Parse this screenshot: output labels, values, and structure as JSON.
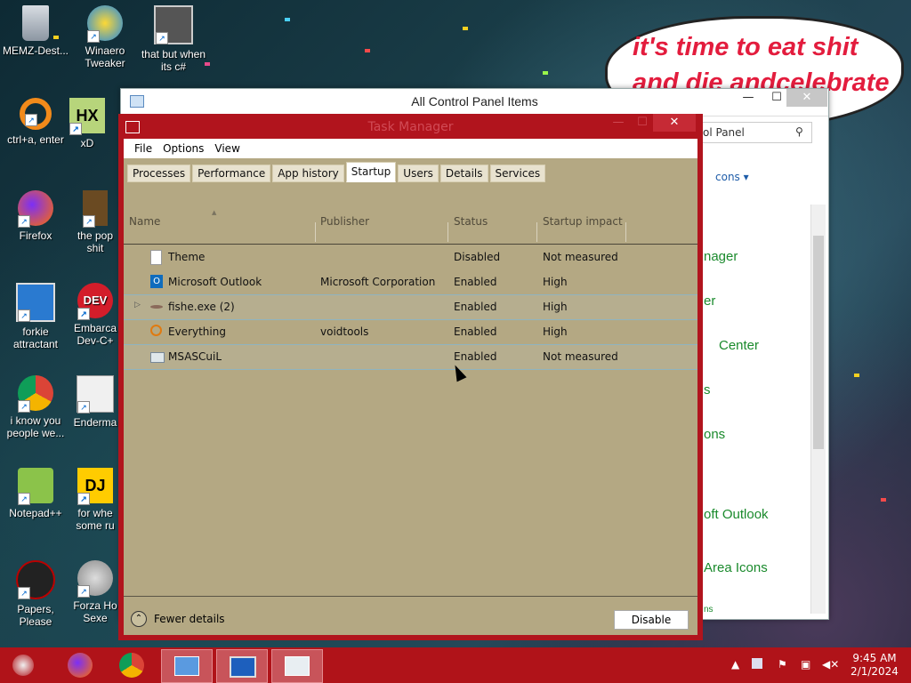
{
  "desktop": {
    "icons": [
      {
        "label": "MEMZ-Dest...",
        "icon": "recycle-bin-icon"
      },
      {
        "label": "Winaero Tweaker",
        "icon": "winaero-icon"
      },
      {
        "label": "that but when its c#",
        "icon": "windows-stack-icon"
      },
      {
        "label": "ctrl+a, enter",
        "icon": "orange-ring-icon"
      },
      {
        "label": "xD",
        "icon": "hxd-icon"
      },
      {
        "label": "Firefox",
        "icon": "firefox-icon"
      },
      {
        "label": "the pop shit",
        "icon": "app-icon"
      },
      {
        "label": "forkie attractant",
        "icon": "settings-monitor-icon"
      },
      {
        "label": "Embarca Dev-C+",
        "icon": "devcpp-icon"
      },
      {
        "label": "i know you people we...",
        "icon": "chrome-icon"
      },
      {
        "label": "Enderma",
        "icon": "app-window-icon"
      },
      {
        "label": "Notepad++",
        "icon": "notepadpp-icon"
      },
      {
        "label": "for whe some ru",
        "icon": "dj-icon"
      },
      {
        "label": "Papers, Please",
        "icon": "papers-please-icon"
      },
      {
        "label": "Forza Ho Sexe",
        "icon": "flash-icon"
      }
    ],
    "bubble_lines": [
      "it's time to eat shit",
      "and die andcelebrate"
    ]
  },
  "control_panel": {
    "title": "All Control Panel Items",
    "search_text": "ol Panel",
    "view_by": "cons",
    "links": [
      "nager",
      "er",
      "Center",
      "s",
      "ons",
      "oft Outlook",
      "Area Icons",
      "ns"
    ]
  },
  "task_manager": {
    "title": "Task Manager",
    "menu": [
      "File",
      "Options",
      "View"
    ],
    "tabs": [
      "Processes",
      "Performance",
      "App history",
      "Startup",
      "Users",
      "Details",
      "Services"
    ],
    "active_tab": "Startup",
    "columns": [
      "Name",
      "Publisher",
      "Status",
      "Startup impact"
    ],
    "rows": [
      {
        "name": "Theme",
        "publisher": "",
        "status": "Disabled",
        "impact": "Not measured"
      },
      {
        "name": "Microsoft Outlook",
        "publisher": "Microsoft Corporation",
        "status": "Enabled",
        "impact": "High"
      },
      {
        "name": "fishe.exe (2)",
        "publisher": "",
        "status": "Enabled",
        "impact": "High"
      },
      {
        "name": "Everything",
        "publisher": "voidtools",
        "status": "Enabled",
        "impact": "High"
      },
      {
        "name": "MSASCuiL",
        "publisher": "",
        "status": "Enabled",
        "impact": "Not measured"
      }
    ],
    "fewer_details": "Fewer details",
    "disable_button": "Disable"
  },
  "taskbar": {
    "time": "9:45 AM",
    "date": "2/1/2024"
  },
  "colors": {
    "accent": "#b01319",
    "tm_body": "#b4a883",
    "link_green": "#1a8a2c"
  }
}
